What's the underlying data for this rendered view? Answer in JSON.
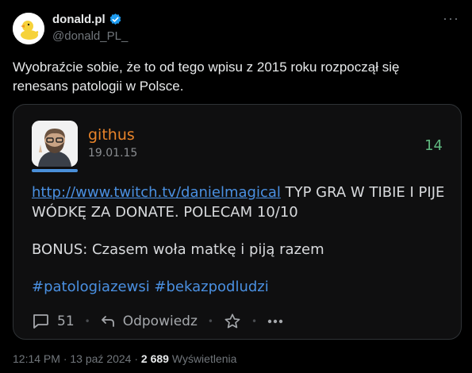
{
  "author": {
    "display_name": "donald.pl",
    "handle": "@donald_PL_",
    "verified": true,
    "avatar_icon": "duck-avatar"
  },
  "tweet": {
    "text": "Wyobraźcie sobie, że to od tego wpisu z 2015 roku rozpoczął się renesans patologii w Polsce."
  },
  "embedded_post": {
    "username": "githus",
    "date": "19.01.15",
    "count": "14",
    "link": "http://www.twitch.tv/danielmagical",
    "text_after_link": " TYP GRA W TIBIE I PIJE WÓDKĘ ZA DONATE. POLECAM 10/10",
    "bonus": "BONUS: Czasem woła matkę i piją razem",
    "hashtags": "#patologiazewsi #bekazpodludzi",
    "comments_count": "51",
    "reply_label": "Odpowiedz",
    "colors": {
      "username": "#e8842a",
      "count": "#5fb87f",
      "link": "#4a90e2"
    }
  },
  "meta": {
    "time": "12:14 PM",
    "separator": " · ",
    "date": "13 paź 2024",
    "views_count": "2 689",
    "views_label": "Wyświetlenia"
  }
}
